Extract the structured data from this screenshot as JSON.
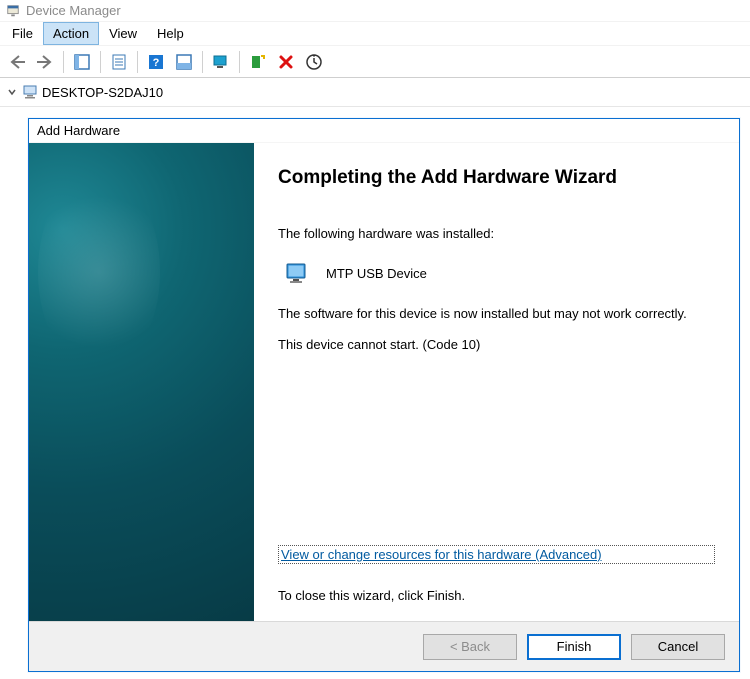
{
  "dm": {
    "title": "Device Manager",
    "menu": {
      "file": "File",
      "action": "Action",
      "view": "View",
      "help": "Help"
    },
    "tree_root": "DESKTOP-S2DAJ10"
  },
  "wizard": {
    "title": "Add Hardware",
    "heading": "Completing the Add Hardware Wizard",
    "installed_intro": "The following hardware was installed:",
    "device_name": "MTP USB Device",
    "warning": "The software for this device is now installed but may not work correctly.",
    "error_code": "This device cannot start. (Code 10)",
    "advanced_link": "View or change resources for this hardware (Advanced)",
    "close_text": "To close this wizard, click Finish.",
    "buttons": {
      "back": "< Back",
      "finish": "Finish",
      "cancel": "Cancel"
    }
  }
}
